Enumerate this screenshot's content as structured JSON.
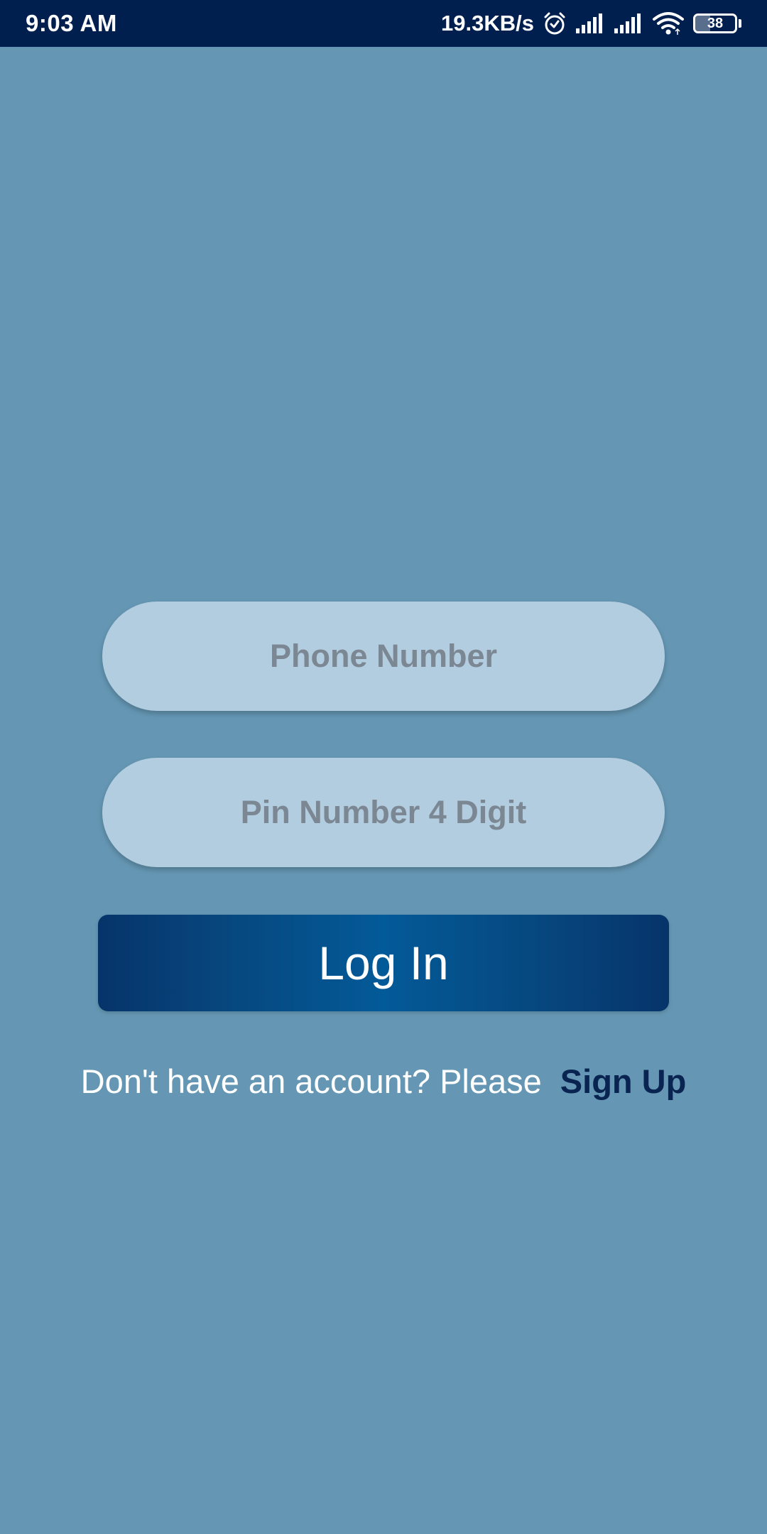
{
  "status_bar": {
    "time": "9:03 AM",
    "net_speed": "19.3KB/s",
    "battery_level": "38",
    "battery_fraction": 0.38,
    "icons": [
      "alarm-icon",
      "signal-icon",
      "signal-icon",
      "wifi-icon",
      "battery-icon"
    ]
  },
  "login_form": {
    "phone_placeholder": "Phone Number",
    "pin_placeholder": "Pin Number 4 Digit",
    "login_label": "Log In"
  },
  "signup": {
    "prompt": "Don't have an account? Please",
    "link_label": "Sign Up"
  },
  "colors": {
    "background": "#6597b4",
    "status_bar": "#001f4f",
    "field_fill": "#b3cde0",
    "button_center": "#035a98",
    "button_edge": "#06346a",
    "signup_link": "#0a2451"
  }
}
